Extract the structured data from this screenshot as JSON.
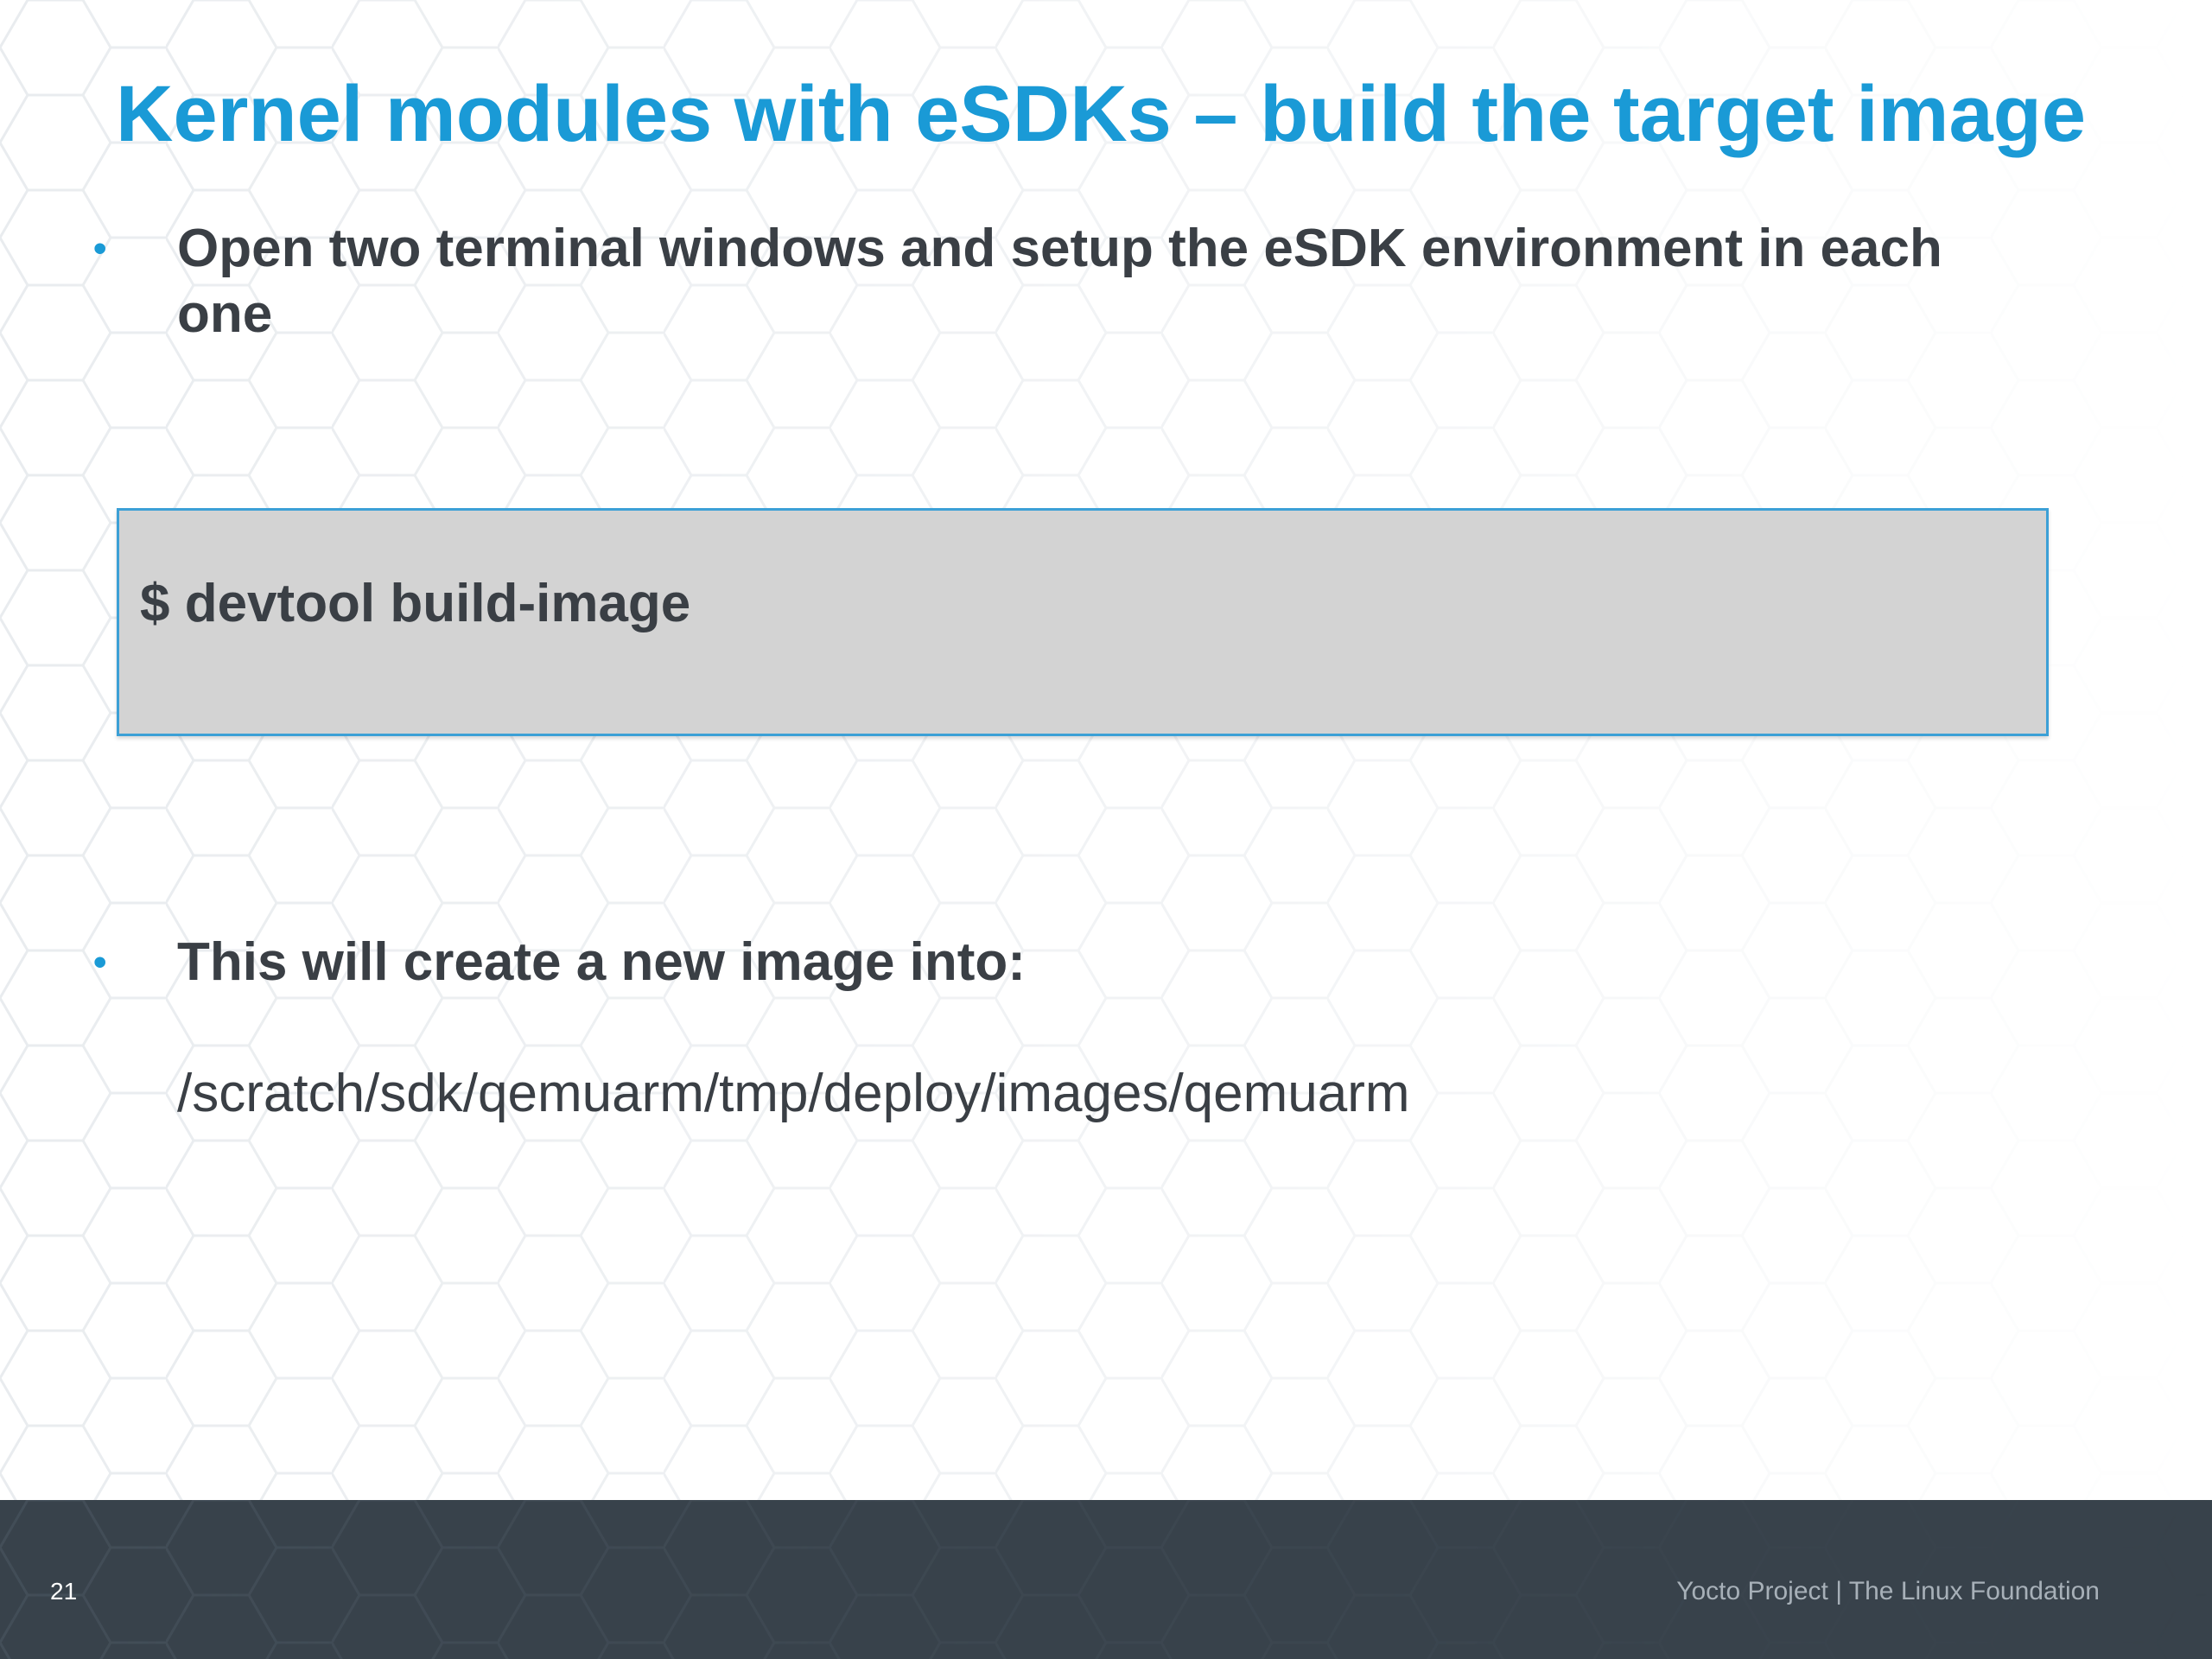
{
  "slide": {
    "title": "Kernel modules with eSDKs – build the target image",
    "bullets": [
      {
        "marker": "•",
        "line1": "Open two terminal windows and setup the eSDK environment in each",
        "line2": "one"
      },
      {
        "marker": "•",
        "text": "This will create a new image into:"
      }
    ],
    "command": "$ devtool build-image",
    "path": "/scratch/sdk/qemuarm/tmp/deploy/images/qemuarm"
  },
  "footer": {
    "page_number": "21",
    "brand": "Yocto Project | The Linux Foundation"
  },
  "colors": {
    "title": "#1a9ad6",
    "text": "#3a3f45",
    "code_background": "#d3d3d3",
    "code_border": "#3ca0d6",
    "footer_background": "#38424b"
  }
}
